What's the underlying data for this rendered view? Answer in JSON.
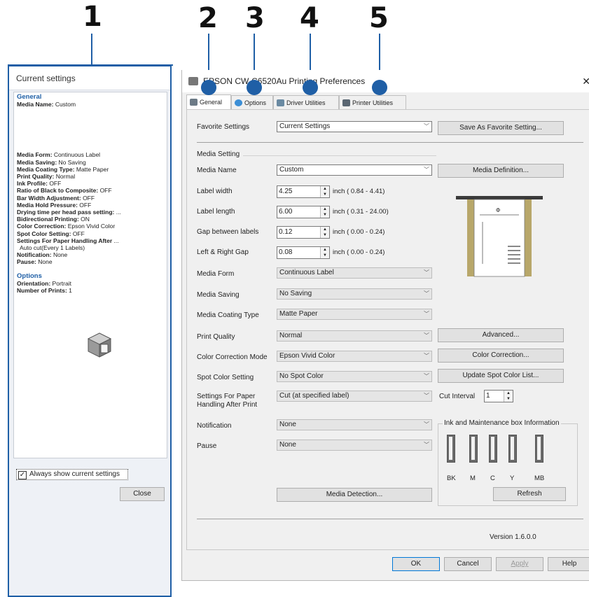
{
  "callouts": [
    "1",
    "2",
    "3",
    "4",
    "5"
  ],
  "current_settings": {
    "title": "Current settings",
    "general_heading": "General",
    "lines": [
      {
        "k": "Media Name:",
        "v": "Custom"
      },
      {
        "k": "Media Form:",
        "v": "Continuous Label"
      },
      {
        "k": "Media Saving:",
        "v": "No Saving"
      },
      {
        "k": "Media Coating Type:",
        "v": "Matte Paper"
      },
      {
        "k": "Print Quality:",
        "v": "Normal"
      },
      {
        "k": "Ink Profile:",
        "v": "OFF"
      },
      {
        "k": "Ratio of Black to Composite:",
        "v": "OFF"
      },
      {
        "k": "Bar Width Adjustment:",
        "v": "OFF"
      },
      {
        "k": "Media Hold Pressure:",
        "v": "OFF"
      },
      {
        "k": "Drying time per head pass setting:",
        "v": "..."
      },
      {
        "k": "Bidirectional Printing:",
        "v": "ON"
      },
      {
        "k": "Color Correction:",
        "v": "Epson Vivid Color"
      },
      {
        "k": "Spot Color Setting:",
        "v": "OFF"
      },
      {
        "k": "Settings For Paper Handling After",
        "v": "..."
      },
      {
        "k": "",
        "v": "Auto cut(Every 1 Labels)"
      },
      {
        "k": "Notification:",
        "v": "None"
      },
      {
        "k": "Pause:",
        "v": "None"
      }
    ],
    "options_heading": "Options",
    "options_lines": [
      {
        "k": "Orientation:",
        "v": "Portrait"
      },
      {
        "k": "Number of Prints:",
        "v": "1"
      }
    ],
    "always_show_label": "Always show current settings",
    "close_label": "Close"
  },
  "dialog": {
    "title": "EPSON CW-C6520Au Printing Preferences",
    "close_glyph": "✕",
    "tabs": [
      "General",
      "Options",
      "Driver Utilities",
      "Printer Utilities"
    ],
    "favorite_settings_label": "Favorite Settings",
    "favorite_settings_value": "Current Settings",
    "save_favorite_label": "Save As Favorite Setting...",
    "media_setting_group": "Media Setting",
    "media_name_label": "Media Name",
    "media_name_value": "Custom",
    "media_definition_label": "Media Definition...",
    "label_width_label": "Label width",
    "label_width_value": "4.25",
    "label_width_range": "inch ( 0.84 - 4.41)",
    "label_length_label": "Label length",
    "label_length_value": "6.00",
    "label_length_range": "inch ( 0.31 - 24.00)",
    "gap_label": "Gap between labels",
    "gap_value": "0.12",
    "gap_range": "inch ( 0.00 - 0.24)",
    "lr_gap_label": "Left & Right Gap",
    "lr_gap_value": "0.08",
    "lr_gap_range": "inch ( 0.00 - 0.24)",
    "media_form_label": "Media Form",
    "media_form_value": "Continuous Label",
    "media_saving_label": "Media Saving",
    "media_saving_value": "No Saving",
    "coating_label": "Media Coating Type",
    "coating_value": "Matte Paper",
    "print_quality_label": "Print Quality",
    "print_quality_value": "Normal",
    "advanced_label": "Advanced...",
    "color_mode_label": "Color Correction Mode",
    "color_mode_value": "Epson Vivid Color",
    "color_correction_label": "Color Correction...",
    "spot_label": "Spot Color Setting",
    "spot_value": "No Spot Color",
    "update_spot_label": "Update Spot Color List...",
    "paper_handling_label_1": "Settings For Paper",
    "paper_handling_label_2": "Handling After Print",
    "paper_handling_value": "Cut (at specified label)",
    "cut_interval_label": "Cut Interval",
    "cut_interval_value": "1",
    "notification_label": "Notification",
    "notification_value": "None",
    "pause_label": "Pause",
    "pause_value": "None",
    "ink_group": "Ink and Maintenance box Information",
    "ink_names": [
      "BK",
      "M",
      "C",
      "Y",
      "MB"
    ],
    "refresh_label": "Refresh",
    "media_detection_label": "Media Detection...",
    "version": "Version 1.6.0.0",
    "ok_label": "OK",
    "cancel_label": "Cancel",
    "apply_label": "Apply",
    "help_label": "Help"
  }
}
